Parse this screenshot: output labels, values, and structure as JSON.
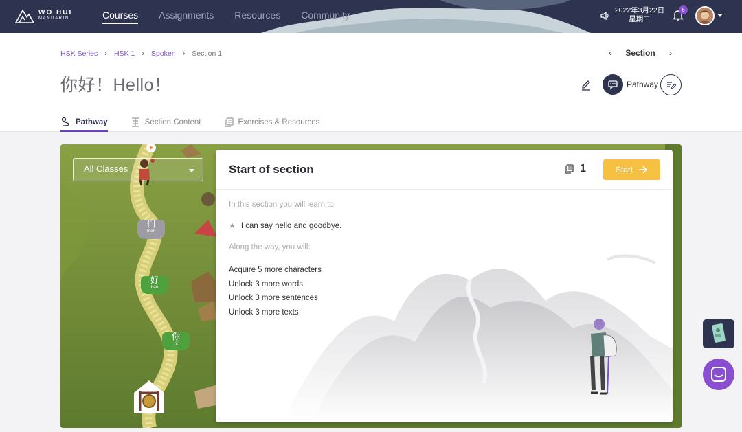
{
  "brand": {
    "line1": "WO HUI",
    "line2": "MANDARIN"
  },
  "nav": [
    {
      "label": "Courses",
      "active": true
    },
    {
      "label": "Assignments",
      "active": false
    },
    {
      "label": "Resources",
      "active": false
    },
    {
      "label": "Community",
      "active": false
    }
  ],
  "topbar": {
    "date": "2022年3月22日",
    "weekday": "星期二",
    "notifications": "6"
  },
  "breadcrumb": [
    "HSK Series",
    "HSK 1",
    "Spoken",
    "Section 1"
  ],
  "section_nav": {
    "label": "Section"
  },
  "page": {
    "title": "你好！Hello！",
    "pathway_label": "Pathway"
  },
  "tabs": [
    {
      "label": "Pathway",
      "active": true,
      "icon": "pathway-icon"
    },
    {
      "label": "Section Content",
      "active": false,
      "icon": "section-content-icon"
    },
    {
      "label": "Exercises & Resources",
      "active": false,
      "icon": "exercises-icon"
    }
  ],
  "map": {
    "class_select": "All Classes",
    "stones": [
      {
        "char": "们",
        "pinyin": "men"
      },
      {
        "char": "好",
        "pinyin": "hǎo"
      },
      {
        "char": "你",
        "pinyin": "nǐ"
      }
    ]
  },
  "card": {
    "title": "Start of section",
    "exercise_count": "1",
    "start_label": "Start",
    "learn_heading": "In this section you will learn to:",
    "objective": "I can say hello and goodbye.",
    "along_heading": "Along the way, you will:",
    "items": [
      "Acquire 5 more characters",
      "Unlock 3 more words",
      "Unlock 3 more sentences",
      "Unlock 3 more texts"
    ]
  },
  "colors": {
    "nav_bg": "#2e3350",
    "accent": "#7d4fc7",
    "start": "#f6c143",
    "map_green": "#6f8a35"
  }
}
